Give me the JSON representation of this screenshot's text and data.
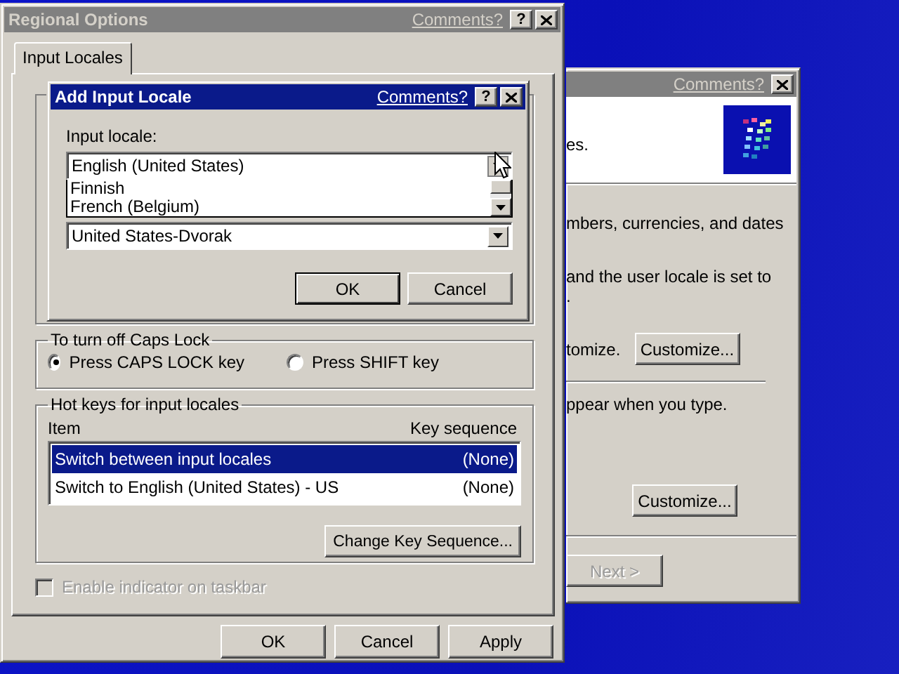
{
  "back_window": {
    "active": false,
    "comments_link": "Comments?",
    "header_text": "es.",
    "intro_text": "mbers, currencies, and dates",
    "locale_lines": [
      "and the user locale is set to",
      "."
    ],
    "customize_row": {
      "text": "tomize.",
      "button": "Customize..."
    },
    "input_text": "ppear when you type.",
    "customize_button_2": "Customize...",
    "next_button": {
      "label": "Next >",
      "disabled": true
    }
  },
  "regional_options": {
    "title": "Regional Options",
    "active": false,
    "comments_link": "Comments?",
    "help_button": "?",
    "tabs": [
      {
        "label": "Input Locales",
        "selected": true
      }
    ],
    "caps_lock": {
      "title": "To turn off Caps Lock",
      "options": [
        {
          "label": "Press CAPS LOCK key",
          "selected": true
        },
        {
          "label": "Press SHIFT key",
          "selected": false
        }
      ]
    },
    "hot_keys": {
      "title": "Hot keys for input locales",
      "columns": [
        "Item",
        "Key sequence"
      ],
      "rows": [
        {
          "item": "Switch between input locales",
          "key": "(None)",
          "selected": true
        },
        {
          "item": "Switch to English (United States) - US",
          "key": "(None)",
          "selected": false
        }
      ],
      "change_button": "Change Key Sequence..."
    },
    "indicator_checkbox": {
      "label": "Enable indicator on taskbar",
      "checked": false,
      "disabled": true
    },
    "buttons": [
      "OK",
      "Cancel",
      "Apply"
    ]
  },
  "add_input_locale": {
    "title": "Add Input Locale",
    "active": true,
    "comments_link": "Comments?",
    "help_button": "?",
    "input_locale_label": "Input locale:",
    "input_locale_value": "English (United States)",
    "dropdown_items": [
      "Finnish",
      "French (Belgium)"
    ],
    "layout_value": "United States-Dvorak",
    "buttons": [
      "OK",
      "Cancel"
    ]
  }
}
